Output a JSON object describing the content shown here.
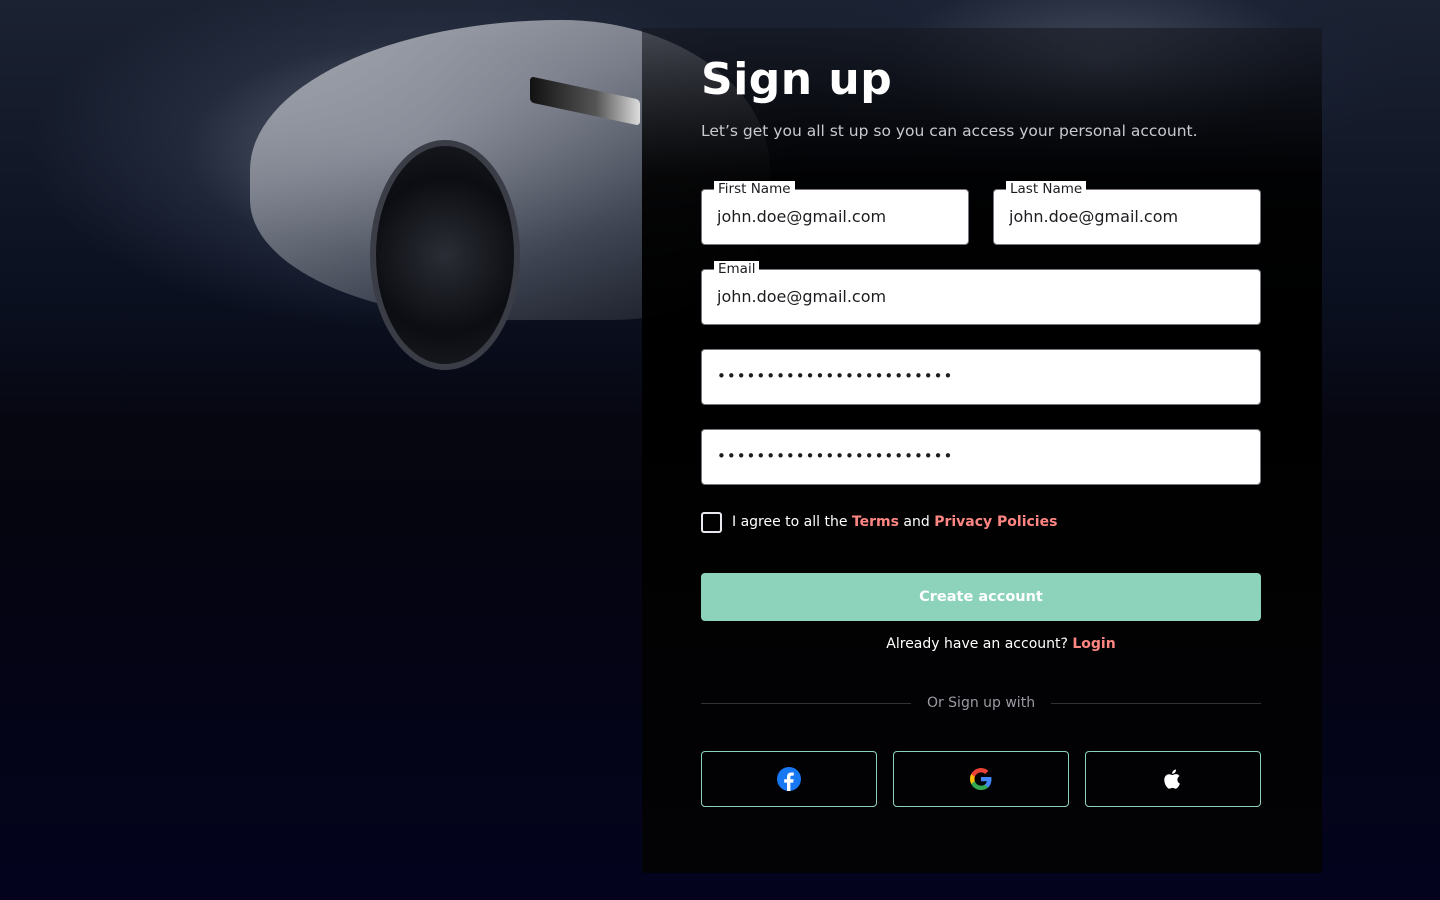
{
  "page": {
    "title": "Sign up",
    "subtitle": "Let’s get you all st up so you can access your personal account."
  },
  "form": {
    "first_name": {
      "label": "First Name",
      "value": "john.doe@gmail.com"
    },
    "last_name": {
      "label": "Last Name",
      "value": "john.doe@gmail.com"
    },
    "email": {
      "label": "Email",
      "value": "john.doe@gmail.com"
    },
    "password": {
      "value": "••••••••••••••••••••••••"
    },
    "confirm_password": {
      "value": "••••••••••••••••••••••••"
    }
  },
  "agreement": {
    "prefix": "I agree to all the",
    "terms": "Terms",
    "and": "and",
    "privacy": "Privacy Policies",
    "checked": false
  },
  "actions": {
    "create_label": "Create account",
    "login_prompt": "Already have an account?",
    "login_link": "Login"
  },
  "social": {
    "divider_text": "Or Sign up with",
    "providers": [
      "facebook-icon",
      "google-icon",
      "apple-icon"
    ]
  },
  "colors": {
    "accent": "#8dd3bb",
    "link": "#ff8682",
    "facebook": "#1877f2"
  }
}
